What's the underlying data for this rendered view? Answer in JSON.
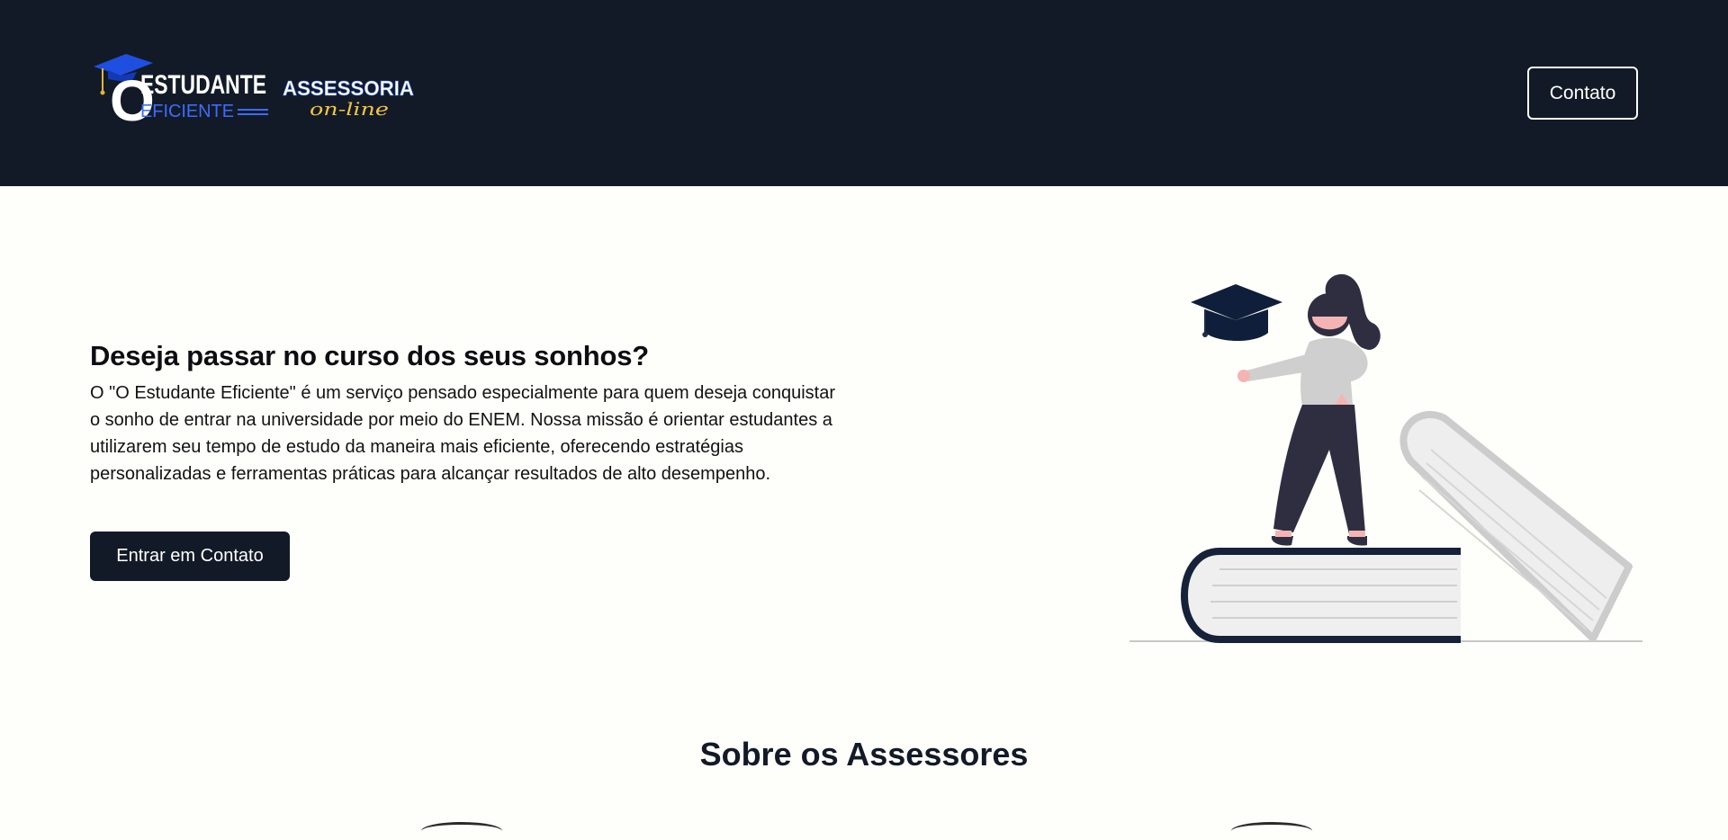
{
  "header": {
    "logo": {
      "brand_line1": "ESTUDANTE",
      "brand_line2": "EFICIENTE",
      "sub_line1": "ASSESSORIA",
      "sub_line2": "on-line",
      "brand_letter": "O"
    },
    "contact_label": "Contato"
  },
  "hero": {
    "title": "Deseja passar no curso dos seus sonhos?",
    "description": "O \"O Estudante Eficiente\" é um serviço pensado especialmente para quem deseja conquistar o sonho de entrar na universidade por meio do ENEM. Nossa missão é orientar estudantes a utilizarem seu tempo de estudo da maneira mais eficiente, oferecendo estratégias personalizadas e ferramentas práticas para alcançar resultados de alto desempenho.",
    "cta_label": "Entrar em Contato"
  },
  "about": {
    "title": "Sobre os Assessores"
  },
  "colors": {
    "header_bg": "#131a27",
    "page_bg": "#fefefa",
    "accent_blue": "#3b6cff",
    "accent_yellow": "#f5c542"
  }
}
